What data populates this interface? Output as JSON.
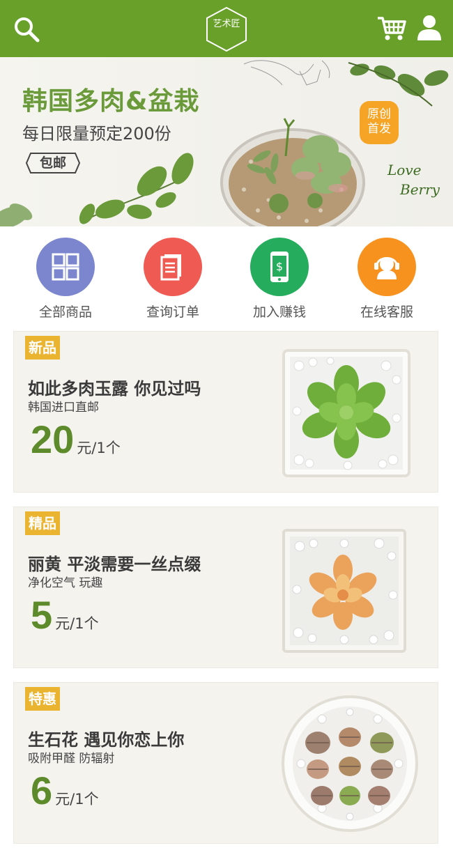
{
  "header": {
    "logo_text": "艺术匠",
    "icons": [
      "search-icon",
      "cart-icon",
      "user-icon"
    ],
    "color": "#68a02a"
  },
  "banner": {
    "title": "韩国多肉&盆栽",
    "subtitle": "每日限量预定200份",
    "tag": "包邮",
    "badge_line1": "原创",
    "badge_line2": "首发",
    "script_line1": "Love",
    "script_line2": "Berry"
  },
  "nav": [
    {
      "label": "全部商品",
      "icon": "grid-icon",
      "color": "#7b86cf"
    },
    {
      "label": "查询订单",
      "icon": "document-icon",
      "color": "#ef5a52"
    },
    {
      "label": "加入赚钱",
      "icon": "phone-money-icon",
      "color": "#25ad5d"
    },
    {
      "label": "在线客服",
      "icon": "headset-agent-icon",
      "color": "#f7921e"
    }
  ],
  "products": [
    {
      "tag": "新品",
      "title": "如此多肉玉露 你见过吗",
      "desc": "韩国进口直邮",
      "price": "20",
      "unit": "元/1个"
    },
    {
      "tag": "精品",
      "title": "丽黄 平淡需要一丝点缀",
      "desc": "净化空气 玩趣",
      "price": "5",
      "unit": "元/1个"
    },
    {
      "tag": "特惠",
      "title": "生石花 遇见你恋上你",
      "desc": "吸附甲醛 防辐射",
      "price": "6",
      "unit": "元/1个"
    }
  ]
}
